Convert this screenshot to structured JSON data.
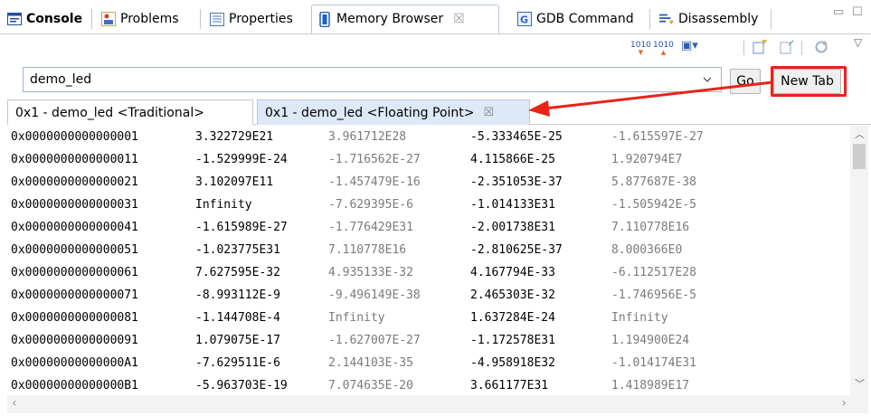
{
  "view_tabs": [
    {
      "label": "Console",
      "icon": "console-icon"
    },
    {
      "label": "Problems",
      "icon": "problems-icon"
    },
    {
      "label": "Properties",
      "icon": "properties-icon"
    },
    {
      "label": "Memory Browser",
      "icon": "memory-browser-icon",
      "close": "☒",
      "active": true
    },
    {
      "label": "GDB Command",
      "icon": "gdb-command-icon"
    },
    {
      "label": "Disassembly",
      "icon": "disassembly-icon"
    }
  ],
  "window_controls": {
    "minimize": "▭",
    "maximize": "☐"
  },
  "toolbar": {
    "icons": [
      "1010",
      "1010",
      "▣▾",
      "import-icon",
      "export-icon",
      "sync-icon",
      "view-menu-icon"
    ]
  },
  "address_bar": {
    "value": "demo_led",
    "go_label": "Go",
    "new_tab_label": "New Tab"
  },
  "memory_tabs": [
    {
      "label": "0x1 - demo_led <Traditional>"
    },
    {
      "label": "0x1 - demo_led <Floating Point>",
      "close": "☒",
      "active": true
    }
  ],
  "rows": [
    {
      "addr": "0x0000000000000001",
      "v": [
        "3.322729E21",
        "3.961712E28",
        "-5.333465E-25",
        "-1.615597E-27"
      ]
    },
    {
      "addr": "0x0000000000000011",
      "v": [
        "-1.529999E-24",
        "-1.716562E-27",
        "4.115866E-25",
        "1.920794E7"
      ]
    },
    {
      "addr": "0x0000000000000021",
      "v": [
        "3.102097E11",
        "-1.457479E-16",
        "-2.351053E-37",
        "5.877687E-38"
      ]
    },
    {
      "addr": "0x0000000000000031",
      "v": [
        "Infinity",
        "-7.629395E-6",
        "-1.014133E31",
        "-1.505942E-5"
      ]
    },
    {
      "addr": "0x0000000000000041",
      "v": [
        "-1.615989E-27",
        "-1.776429E31",
        "-2.001738E31",
        "7.110778E16"
      ]
    },
    {
      "addr": "0x0000000000000051",
      "v": [
        "-1.023775E31",
        "7.110778E16",
        "-2.810625E-37",
        "8.000366E0"
      ]
    },
    {
      "addr": "0x0000000000000061",
      "v": [
        "7.627595E-32",
        "4.935133E-32",
        "4.167794E-33",
        "-6.112517E28"
      ]
    },
    {
      "addr": "0x0000000000000071",
      "v": [
        "-8.993112E-9",
        "-9.496149E-38",
        "2.465303E-32",
        "-1.746956E-5"
      ]
    },
    {
      "addr": "0x0000000000000081",
      "v": [
        "-1.144708E-4",
        "Infinity",
        "1.637284E-24",
        "Infinity"
      ]
    },
    {
      "addr": "0x0000000000000091",
      "v": [
        "1.079075E-17",
        "-1.627007E-27",
        "-1.172578E31",
        "1.194900E24"
      ]
    },
    {
      "addr": "0x00000000000000A1",
      "v": [
        "-7.629511E-6",
        "2.144103E-35",
        "-4.958918E32",
        "-1.014174E31"
      ]
    },
    {
      "addr": "0x00000000000000B1",
      "v": [
        "-5.963703E-19",
        "7.074635E-20",
        "3.661177E31",
        "1.418989E17"
      ]
    }
  ],
  "colors": {
    "annotation_red": "#e8231a",
    "active_tab_bg": "#dde9f7",
    "secondary_value_gray": "#7b7b7b"
  }
}
